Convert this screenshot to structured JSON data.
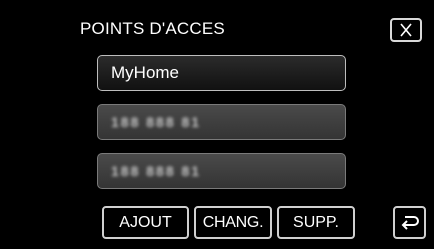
{
  "header": {
    "title": "POINTS D'ACCES",
    "close_icon": "close-x-icon"
  },
  "access_points": [
    {
      "label": "MyHome",
      "state": "selected"
    },
    {
      "label": "188 888 81",
      "state": "obscured"
    },
    {
      "label": "188 888 81",
      "state": "obscured"
    }
  ],
  "actions": {
    "add_label": "AJOUT",
    "change_label": "CHANG.",
    "delete_label": "SUPP.",
    "back_icon": "return-arrow-icon"
  }
}
